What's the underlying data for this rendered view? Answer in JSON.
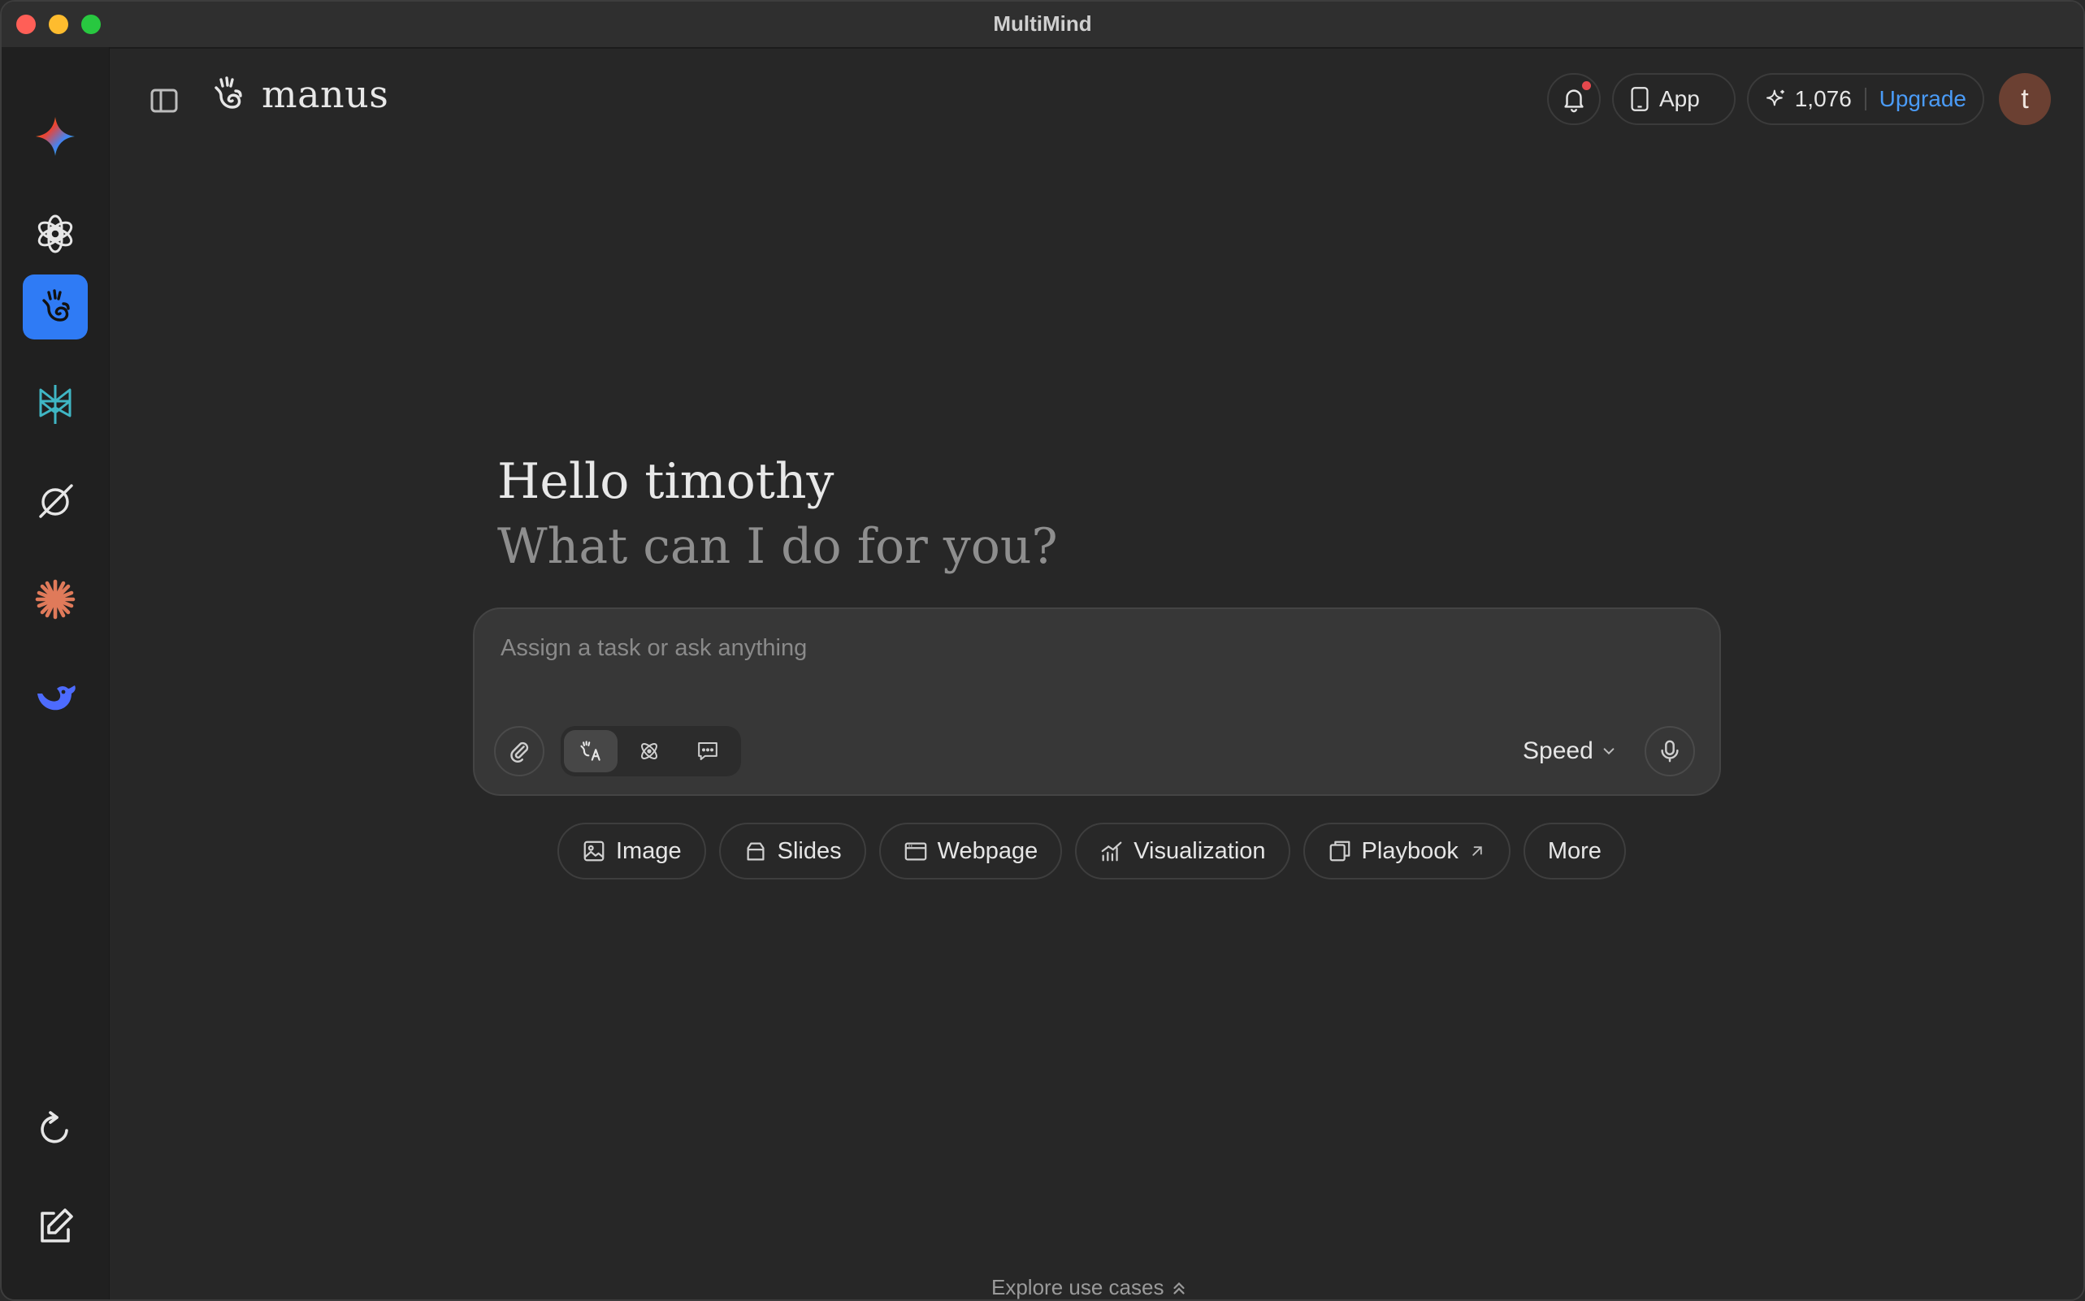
{
  "window": {
    "title": "MultiMind"
  },
  "rail": {
    "items": [
      {
        "name": "gemini-icon"
      },
      {
        "name": "openai-icon"
      },
      {
        "name": "manus-icon",
        "active": true
      },
      {
        "name": "perplexity-icon"
      },
      {
        "name": "grok-icon"
      },
      {
        "name": "claude-icon"
      },
      {
        "name": "deepseek-icon"
      }
    ],
    "bottom": [
      {
        "name": "refresh-icon"
      },
      {
        "name": "compose-icon"
      }
    ]
  },
  "header": {
    "brand": "manus",
    "app_label": "App",
    "credits": "1,076",
    "upgrade_label": "Upgrade",
    "avatar_initial": "t",
    "notification_dot_color": "#e5484d"
  },
  "greeting": {
    "line1": "Hello timothy",
    "line2": "What can I do for you?"
  },
  "composer": {
    "placeholder": "Assign a task or ask anything",
    "value": "",
    "speed_label": "Speed"
  },
  "chips": [
    {
      "label": "Image",
      "icon": "image-icon"
    },
    {
      "label": "Slides",
      "icon": "slides-icon"
    },
    {
      "label": "Webpage",
      "icon": "webpage-icon"
    },
    {
      "label": "Visualization",
      "icon": "chart-icon"
    },
    {
      "label": "Playbook",
      "icon": "playbook-icon"
    },
    {
      "label": "More",
      "icon": ""
    }
  ],
  "footer": {
    "explore_label": "Explore use cases"
  },
  "colors": {
    "accent": "#2f7bf5",
    "upgrade": "#4a9bf7"
  }
}
